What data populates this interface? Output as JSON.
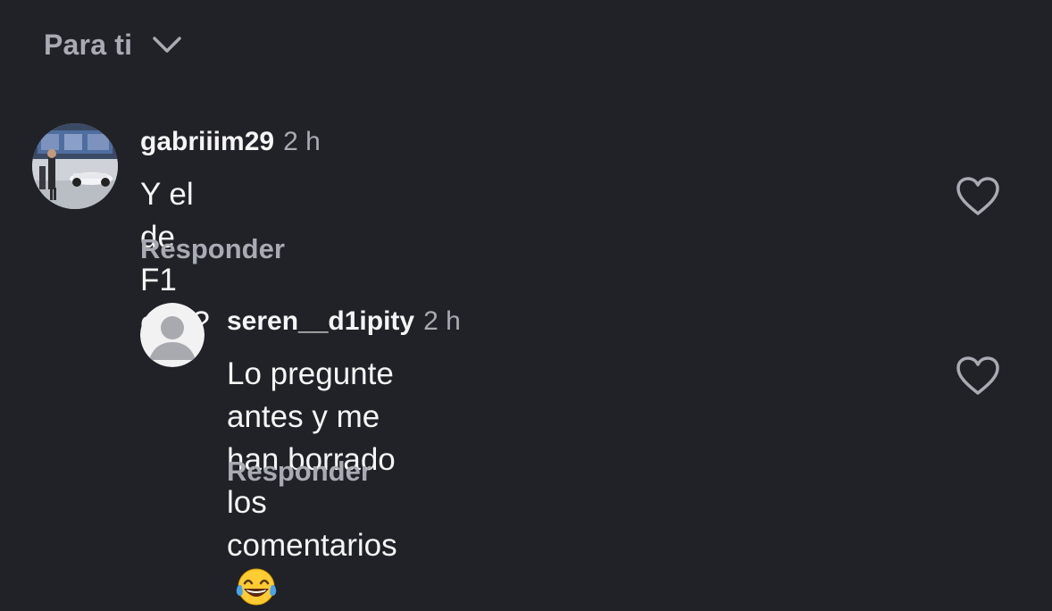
{
  "header": {
    "sort_label": "Para ti",
    "sort_icon": "chevron-down-icon"
  },
  "comments": [
    {
      "username": "gabriiim29",
      "time": "2 h",
      "text": "Y el de F1 qué?",
      "reply_label": "Responder",
      "avatar": "photo-avatar",
      "like_icon": "heart-outline-icon"
    }
  ],
  "replies": [
    {
      "username": "seren__d1ipity",
      "time": "2 h",
      "text_line1": "Lo pregunte antes y me han borrado",
      "text_line2": "los comentarios",
      "emoji": "😂",
      "reply_label": "Responder",
      "avatar": "default-avatar",
      "like_icon": "heart-outline-icon"
    }
  ],
  "colors": {
    "background": "#212227",
    "primary_text": "#f5f5f5",
    "secondary_text": "#a8abb3",
    "default_avatar_bg": "#f2f2f2",
    "default_avatar_fg": "#a9aaaf"
  }
}
